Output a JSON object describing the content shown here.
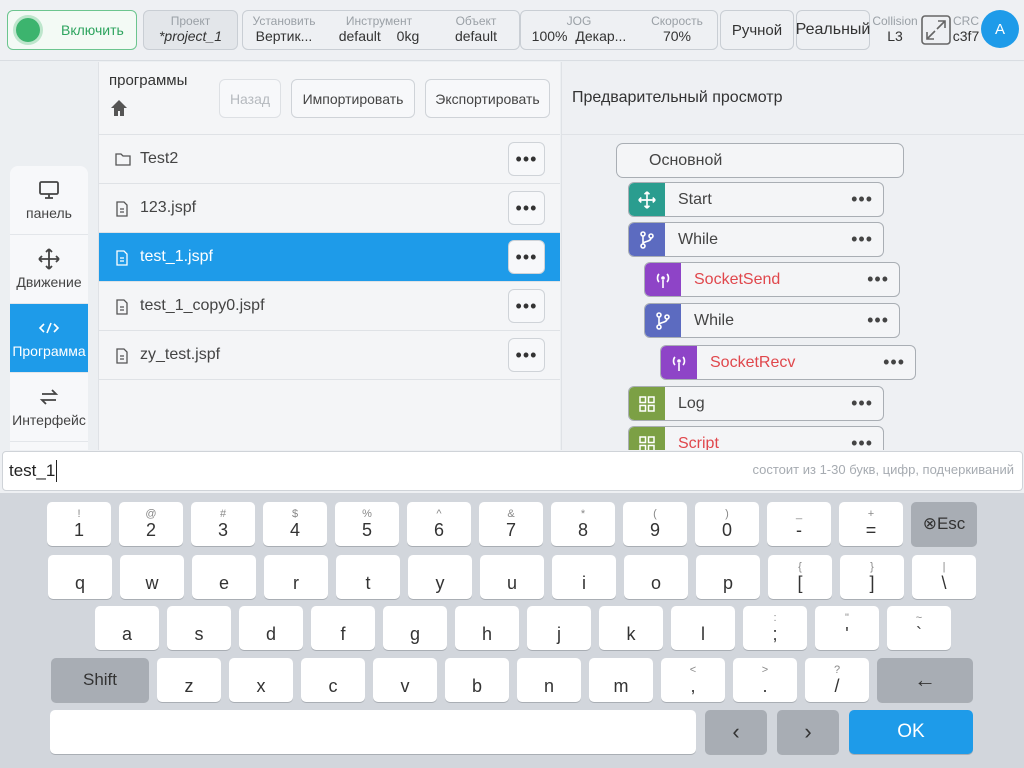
{
  "topbar": {
    "enable_label": "Включить",
    "project": {
      "label": "Проект",
      "value": "*project_1"
    },
    "install": {
      "label": "Установить",
      "value": "Вертик..."
    },
    "tool": {
      "label": "Инструмент",
      "value1": "default",
      "value2": "0kg"
    },
    "object": {
      "label": "Объект",
      "value": "default"
    },
    "jog": {
      "label": "JOG",
      "value1": "100%",
      "value2": "Декар..."
    },
    "speed": {
      "label": "Скорость",
      "value": "70%"
    },
    "mode_label": "Ручной",
    "real_label": "Реальный",
    "collision": {
      "label": "Collision",
      "value": "L3"
    },
    "crc": {
      "label": "CRC",
      "value": "c3f7"
    },
    "avatar": "A"
  },
  "nav": [
    {
      "label": "панель",
      "icon": "monitor-icon"
    },
    {
      "label": "Движение",
      "icon": "move-icon"
    },
    {
      "label": "Программа",
      "icon": "code-icon"
    },
    {
      "label": "Интерфейс",
      "icon": "swap-icon"
    }
  ],
  "files": {
    "title": "программы",
    "back_label": "Назад",
    "import_label": "Импортировать",
    "export_label": "Экспортировать",
    "items": [
      {
        "name": "Test2",
        "type": "folder"
      },
      {
        "name": "123.jspf",
        "type": "file"
      },
      {
        "name": "test_1.jspf",
        "type": "file",
        "selected": true
      },
      {
        "name": "test_1_copy0.jspf",
        "type": "file"
      },
      {
        "name": "zy_test.jspf",
        "type": "file"
      }
    ],
    "more_label": "•••"
  },
  "preview": {
    "title": "Предварительный просмотр",
    "main_label": "Основной",
    "blocks": [
      {
        "label": "Start",
        "color": "#2a9d8f",
        "icon": "move-icon"
      },
      {
        "label": "While",
        "color": "#5c6bc0",
        "icon": "branch-icon"
      },
      {
        "label": "SocketSend",
        "color": "#8e44c7",
        "icon": "antenna-icon",
        "error": true
      },
      {
        "label": "While",
        "color": "#5c6bc0",
        "icon": "branch-icon"
      },
      {
        "label": "SocketRecv",
        "color": "#8e44c7",
        "icon": "antenna-icon",
        "error": true
      },
      {
        "label": "Log",
        "color": "#7ca045",
        "icon": "grid-icon"
      },
      {
        "label": "Script",
        "color": "#7ca045",
        "icon": "grid-icon",
        "error": true
      }
    ]
  },
  "input": {
    "value": "test_1",
    "hint": "состоит из 1-30 букв, цифр, подчеркиваний"
  },
  "keyboard": {
    "row1": [
      {
        "sub": "!",
        "main": "1"
      },
      {
        "sub": "@",
        "main": "2"
      },
      {
        "sub": "#",
        "main": "3"
      },
      {
        "sub": "$",
        "main": "4"
      },
      {
        "sub": "%",
        "main": "5"
      },
      {
        "sub": "^",
        "main": "6"
      },
      {
        "sub": "&",
        "main": "7"
      },
      {
        "sub": "*",
        "main": "8"
      },
      {
        "sub": "(",
        "main": "9"
      },
      {
        "sub": ")",
        "main": "0"
      },
      {
        "sub": "_",
        "main": "-"
      },
      {
        "sub": "+",
        "main": "="
      }
    ],
    "esc_label": "⊗Esc",
    "row2": [
      {
        "sub": "",
        "main": "q"
      },
      {
        "sub": "",
        "main": "w"
      },
      {
        "sub": "",
        "main": "e"
      },
      {
        "sub": "",
        "main": "r"
      },
      {
        "sub": "",
        "main": "t"
      },
      {
        "sub": "",
        "main": "y"
      },
      {
        "sub": "",
        "main": "u"
      },
      {
        "sub": "",
        "main": "i"
      },
      {
        "sub": "",
        "main": "o"
      },
      {
        "sub": "",
        "main": "p"
      },
      {
        "sub": "{",
        "main": "["
      },
      {
        "sub": "}",
        "main": "]"
      },
      {
        "sub": "|",
        "main": "\\"
      }
    ],
    "row3": [
      {
        "sub": "",
        "main": "a"
      },
      {
        "sub": "",
        "main": "s"
      },
      {
        "sub": "",
        "main": "d"
      },
      {
        "sub": "",
        "main": "f"
      },
      {
        "sub": "",
        "main": "g"
      },
      {
        "sub": "",
        "main": "h"
      },
      {
        "sub": "",
        "main": "j"
      },
      {
        "sub": "",
        "main": "k"
      },
      {
        "sub": "",
        "main": "l"
      },
      {
        "sub": ":",
        "main": ";"
      },
      {
        "sub": "\"",
        "main": "'"
      },
      {
        "sub": "~",
        "main": "`"
      }
    ],
    "shift_label": "Shift",
    "row4": [
      {
        "sub": "",
        "main": "z"
      },
      {
        "sub": "",
        "main": "x"
      },
      {
        "sub": "",
        "main": "c"
      },
      {
        "sub": "",
        "main": "v"
      },
      {
        "sub": "",
        "main": "b"
      },
      {
        "sub": "",
        "main": "n"
      },
      {
        "sub": "",
        "main": "m"
      },
      {
        "sub": "<",
        "main": ","
      },
      {
        "sub": ">",
        "main": "."
      },
      {
        "sub": "?",
        "main": "/"
      }
    ],
    "backspace_label": "←",
    "left_label": "‹",
    "right_label": "›",
    "ok_label": "OK"
  }
}
